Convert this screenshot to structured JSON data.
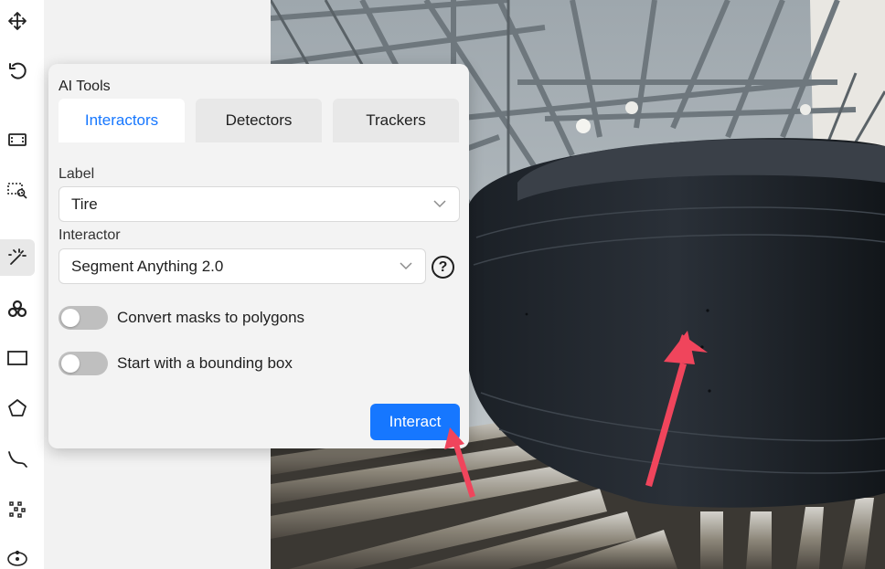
{
  "toolbar": {
    "tools": [
      {
        "icon": "move-icon"
      },
      {
        "icon": "undo-icon"
      },
      {
        "icon": "fit-image-icon"
      },
      {
        "icon": "zoom-region-icon"
      },
      {
        "icon": "magic-wand-icon",
        "active": true
      },
      {
        "icon": "openvino-icon"
      },
      {
        "icon": "rectangle-icon"
      },
      {
        "icon": "polygon-icon"
      },
      {
        "icon": "polyline-icon"
      },
      {
        "icon": "points-icon"
      },
      {
        "icon": "ellipse-icon"
      }
    ]
  },
  "panel": {
    "title": "AI Tools",
    "tabs": [
      {
        "label": "Interactors",
        "active": true
      },
      {
        "label": "Detectors"
      },
      {
        "label": "Trackers"
      }
    ],
    "label_field": {
      "caption": "Label",
      "value": "Tire"
    },
    "interactor_field": {
      "caption": "Interactor",
      "value": "Segment Anything 2.0"
    },
    "help_symbol": "?",
    "toggles": [
      {
        "label": "Convert masks to polygons",
        "on": false
      },
      {
        "label": "Start with a bounding box",
        "on": false
      }
    ],
    "interact_button": "Interact"
  },
  "colors": {
    "accent": "#1677ff",
    "annotation_arrow": "#f0455c",
    "panel_bg": "#f3f3f3"
  }
}
